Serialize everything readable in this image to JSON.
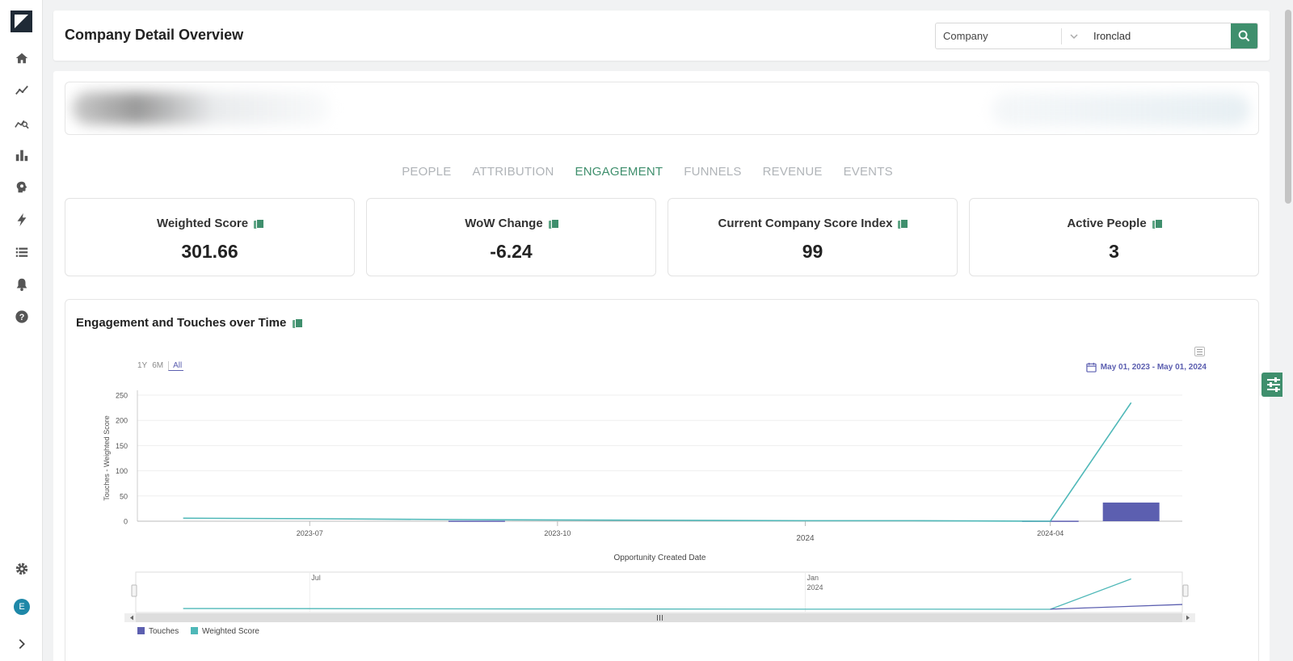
{
  "sidebar": {
    "items": [
      {
        "name": "home-icon"
      },
      {
        "name": "trend-icon"
      },
      {
        "name": "analytics-search-icon"
      },
      {
        "name": "bar-chart-icon"
      },
      {
        "name": "brain-icon"
      },
      {
        "name": "lightning-icon"
      },
      {
        "name": "list-icon"
      },
      {
        "name": "bell-icon"
      },
      {
        "name": "help-icon"
      }
    ],
    "settings_icon": "gear-icon",
    "avatar_initial": "E",
    "expand_icon": "chevron-right-icon"
  },
  "header": {
    "title": "Company Detail Overview",
    "search_type": "Company",
    "search_value": "Ironclad"
  },
  "tabs": [
    {
      "label": "PEOPLE",
      "active": false
    },
    {
      "label": "ATTRIBUTION",
      "active": false
    },
    {
      "label": "ENGAGEMENT",
      "active": true
    },
    {
      "label": "FUNNELS",
      "active": false
    },
    {
      "label": "REVENUE",
      "active": false
    },
    {
      "label": "EVENTS",
      "active": false
    }
  ],
  "kpis": [
    {
      "label": "Weighted Score",
      "value": "301.66"
    },
    {
      "label": "WoW Change",
      "value": "-6.24"
    },
    {
      "label": "Current Company Score Index",
      "value": "99"
    },
    {
      "label": "Active People",
      "value": "3"
    }
  ],
  "chart_section": {
    "title": "Engagement and Touches over Time",
    "range_buttons": [
      "1Y",
      "6M",
      "All"
    ],
    "selected_range": "All",
    "date_range": "May 01, 2023 - May 01, 2024"
  },
  "chart_data": {
    "type": "line",
    "xlabel": "Opportunity Created Date",
    "ylabel": "Touches - Weighted Score",
    "ylim": [
      0,
      250
    ],
    "yticks": [
      0,
      50,
      100,
      150,
      200,
      250
    ],
    "xticks": [
      "2023-07",
      "2023-10",
      "2024",
      "2024-04"
    ],
    "navigator_labels": [
      "Jul",
      "Jan",
      "2024"
    ],
    "series": [
      {
        "name": "Weighted Score",
        "kind": "line",
        "color": "#4fb8b8",
        "points": [
          [
            "2023-05-15",
            6
          ],
          [
            "2023-07-01",
            5
          ],
          [
            "2023-09-01",
            3
          ],
          [
            "2023-11-01",
            2
          ],
          [
            "2024-01-01",
            1
          ],
          [
            "2024-02-10",
            1
          ],
          [
            "2024-04-01",
            0
          ],
          [
            "2024-05-01",
            235
          ]
        ]
      },
      {
        "name": "Touches",
        "kind": "bar",
        "color": "#5c5fb0",
        "points": [
          [
            "2023-09-01",
            1
          ],
          [
            "2024-04-01",
            1
          ],
          [
            "2024-05-01",
            37
          ]
        ]
      }
    ],
    "legend_position": "bottom-left"
  },
  "colors": {
    "accent": "#3f8f6d",
    "touches": "#5c5fb0",
    "weighted": "#4fb8b8"
  }
}
